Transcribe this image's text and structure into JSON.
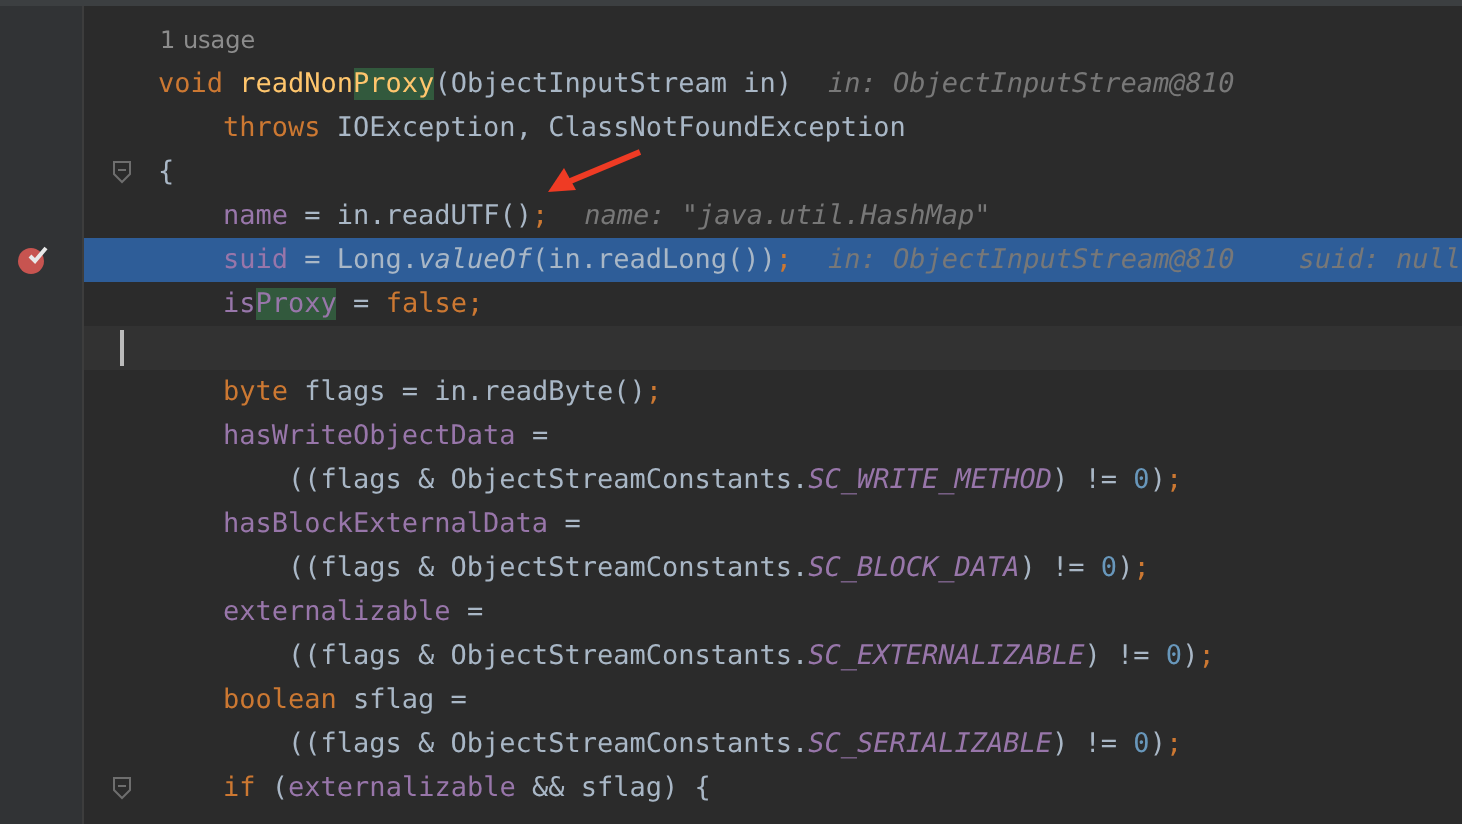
{
  "usage_hint": "1 usage",
  "lines": [
    {
      "code": [
        {
          "text": "void",
          "kind": "kw"
        },
        {
          "text": " readNon",
          "kind": "method"
        },
        {
          "text": "Proxy",
          "kind": "method-match"
        },
        {
          "text": "(ObjectInputStream in)",
          "kind": "plain"
        }
      ],
      "hints": [
        "in: ObjectInputStream@810"
      ],
      "execution": false,
      "breakpoint": false,
      "current": false,
      "fold": false
    },
    {
      "code": [
        {
          "text": "    throws",
          "kind": "kw"
        },
        {
          "text": " IOException, ClassNotFoundException",
          "kind": "plain"
        }
      ],
      "execution": false,
      "breakpoint": false,
      "current": false,
      "fold": false
    },
    {
      "code": [
        {
          "text": "{",
          "kind": "plain"
        }
      ],
      "execution": false,
      "breakpoint": false,
      "current": false,
      "fold": true
    },
    {
      "code": [
        {
          "text": "    name",
          "kind": "field"
        },
        {
          "text": " = in.readUTF()",
          "kind": "plain"
        },
        {
          "text": ";",
          "kind": "semi"
        }
      ],
      "hints": [
        "name: \"java.util.HashMap\""
      ],
      "execution": false,
      "breakpoint": false,
      "current": false,
      "fold": false
    },
    {
      "code": [
        {
          "text": "    suid",
          "kind": "field"
        },
        {
          "text": " = Long.",
          "kind": "plain"
        },
        {
          "text": "valueOf",
          "kind": "italic"
        },
        {
          "text": "(in.readLong())",
          "kind": "plain"
        },
        {
          "text": ";",
          "kind": "semi"
        }
      ],
      "hints": [
        "in: ObjectInputStream@810",
        "suid: null"
      ],
      "execution": true,
      "breakpoint": true,
      "current": false,
      "fold": false
    },
    {
      "code": [
        {
          "text": "    is",
          "kind": "field"
        },
        {
          "text": "Proxy",
          "kind": "field-match"
        },
        {
          "text": " = ",
          "kind": "plain"
        },
        {
          "text": "false;",
          "kind": "kw"
        }
      ],
      "execution": false,
      "breakpoint": false,
      "current": false,
      "fold": false
    },
    {
      "execution": false,
      "breakpoint": false,
      "current": true,
      "fold": false
    },
    {
      "code": [
        {
          "text": "    byte",
          "kind": "kw"
        },
        {
          "text": " flags = in.readByte()",
          "kind": "plain"
        },
        {
          "text": ";",
          "kind": "semi"
        }
      ],
      "execution": false,
      "breakpoint": false,
      "current": false,
      "fold": false
    },
    {
      "code": [
        {
          "text": "    hasWriteObjectData",
          "kind": "field"
        },
        {
          "text": " =",
          "kind": "plain"
        }
      ],
      "execution": false,
      "breakpoint": false,
      "current": false,
      "fold": false
    },
    {
      "code": [
        {
          "text": "        ((flags & ObjectStreamConstants.",
          "kind": "plain"
        },
        {
          "text": "SC_WRITE_METHOD",
          "kind": "const"
        },
        {
          "text": ") != ",
          "kind": "plain"
        },
        {
          "text": "0",
          "kind": "num"
        },
        {
          "text": ")",
          "kind": "plain"
        },
        {
          "text": ";",
          "kind": "semi"
        }
      ],
      "execution": false,
      "breakpoint": false,
      "current": false,
      "fold": false
    },
    {
      "code": [
        {
          "text": "    hasBlockExternalData",
          "kind": "field"
        },
        {
          "text": " =",
          "kind": "plain"
        }
      ],
      "execution": false,
      "breakpoint": false,
      "current": false,
      "fold": false
    },
    {
      "code": [
        {
          "text": "        ((flags & ObjectStreamConstants.",
          "kind": "plain"
        },
        {
          "text": "SC_BLOCK_DATA",
          "kind": "const"
        },
        {
          "text": ") != ",
          "kind": "plain"
        },
        {
          "text": "0",
          "kind": "num"
        },
        {
          "text": ")",
          "kind": "plain"
        },
        {
          "text": ";",
          "kind": "semi"
        }
      ],
      "execution": false,
      "breakpoint": false,
      "current": false,
      "fold": false
    },
    {
      "code": [
        {
          "text": "    externalizable",
          "kind": "field"
        },
        {
          "text": " =",
          "kind": "plain"
        }
      ],
      "execution": false,
      "breakpoint": false,
      "current": false,
      "fold": false
    },
    {
      "code": [
        {
          "text": "        ((flags & ObjectStreamConstants.",
          "kind": "plain"
        },
        {
          "text": "SC_EXTERNALIZABLE",
          "kind": "const"
        },
        {
          "text": ") != ",
          "kind": "plain"
        },
        {
          "text": "0",
          "kind": "num"
        },
        {
          "text": ")",
          "kind": "plain"
        },
        {
          "text": ";",
          "kind": "semi"
        }
      ],
      "execution": false,
      "breakpoint": false,
      "current": false,
      "fold": false
    },
    {
      "code": [
        {
          "text": "    boolean",
          "kind": "kw"
        },
        {
          "text": " sflag =",
          "kind": "plain"
        }
      ],
      "execution": false,
      "breakpoint": false,
      "current": false,
      "fold": false
    },
    {
      "code": [
        {
          "text": "        ((flags & ObjectStreamConstants.",
          "kind": "plain"
        },
        {
          "text": "SC_SERIALIZABLE",
          "kind": "const"
        },
        {
          "text": ") != ",
          "kind": "plain"
        },
        {
          "text": "0",
          "kind": "num"
        },
        {
          "text": ")",
          "kind": "plain"
        },
        {
          "text": ";",
          "kind": "semi"
        }
      ],
      "execution": false,
      "breakpoint": false,
      "current": false,
      "fold": false
    },
    {
      "code": [
        {
          "text": "    if",
          "kind": "kw"
        },
        {
          "text": " (",
          "kind": "plain"
        },
        {
          "text": "externalizable",
          "kind": "field"
        },
        {
          "text": " && sflag) {",
          "kind": "plain"
        }
      ],
      "execution": false,
      "breakpoint": false,
      "current": false,
      "fold": true
    }
  ]
}
